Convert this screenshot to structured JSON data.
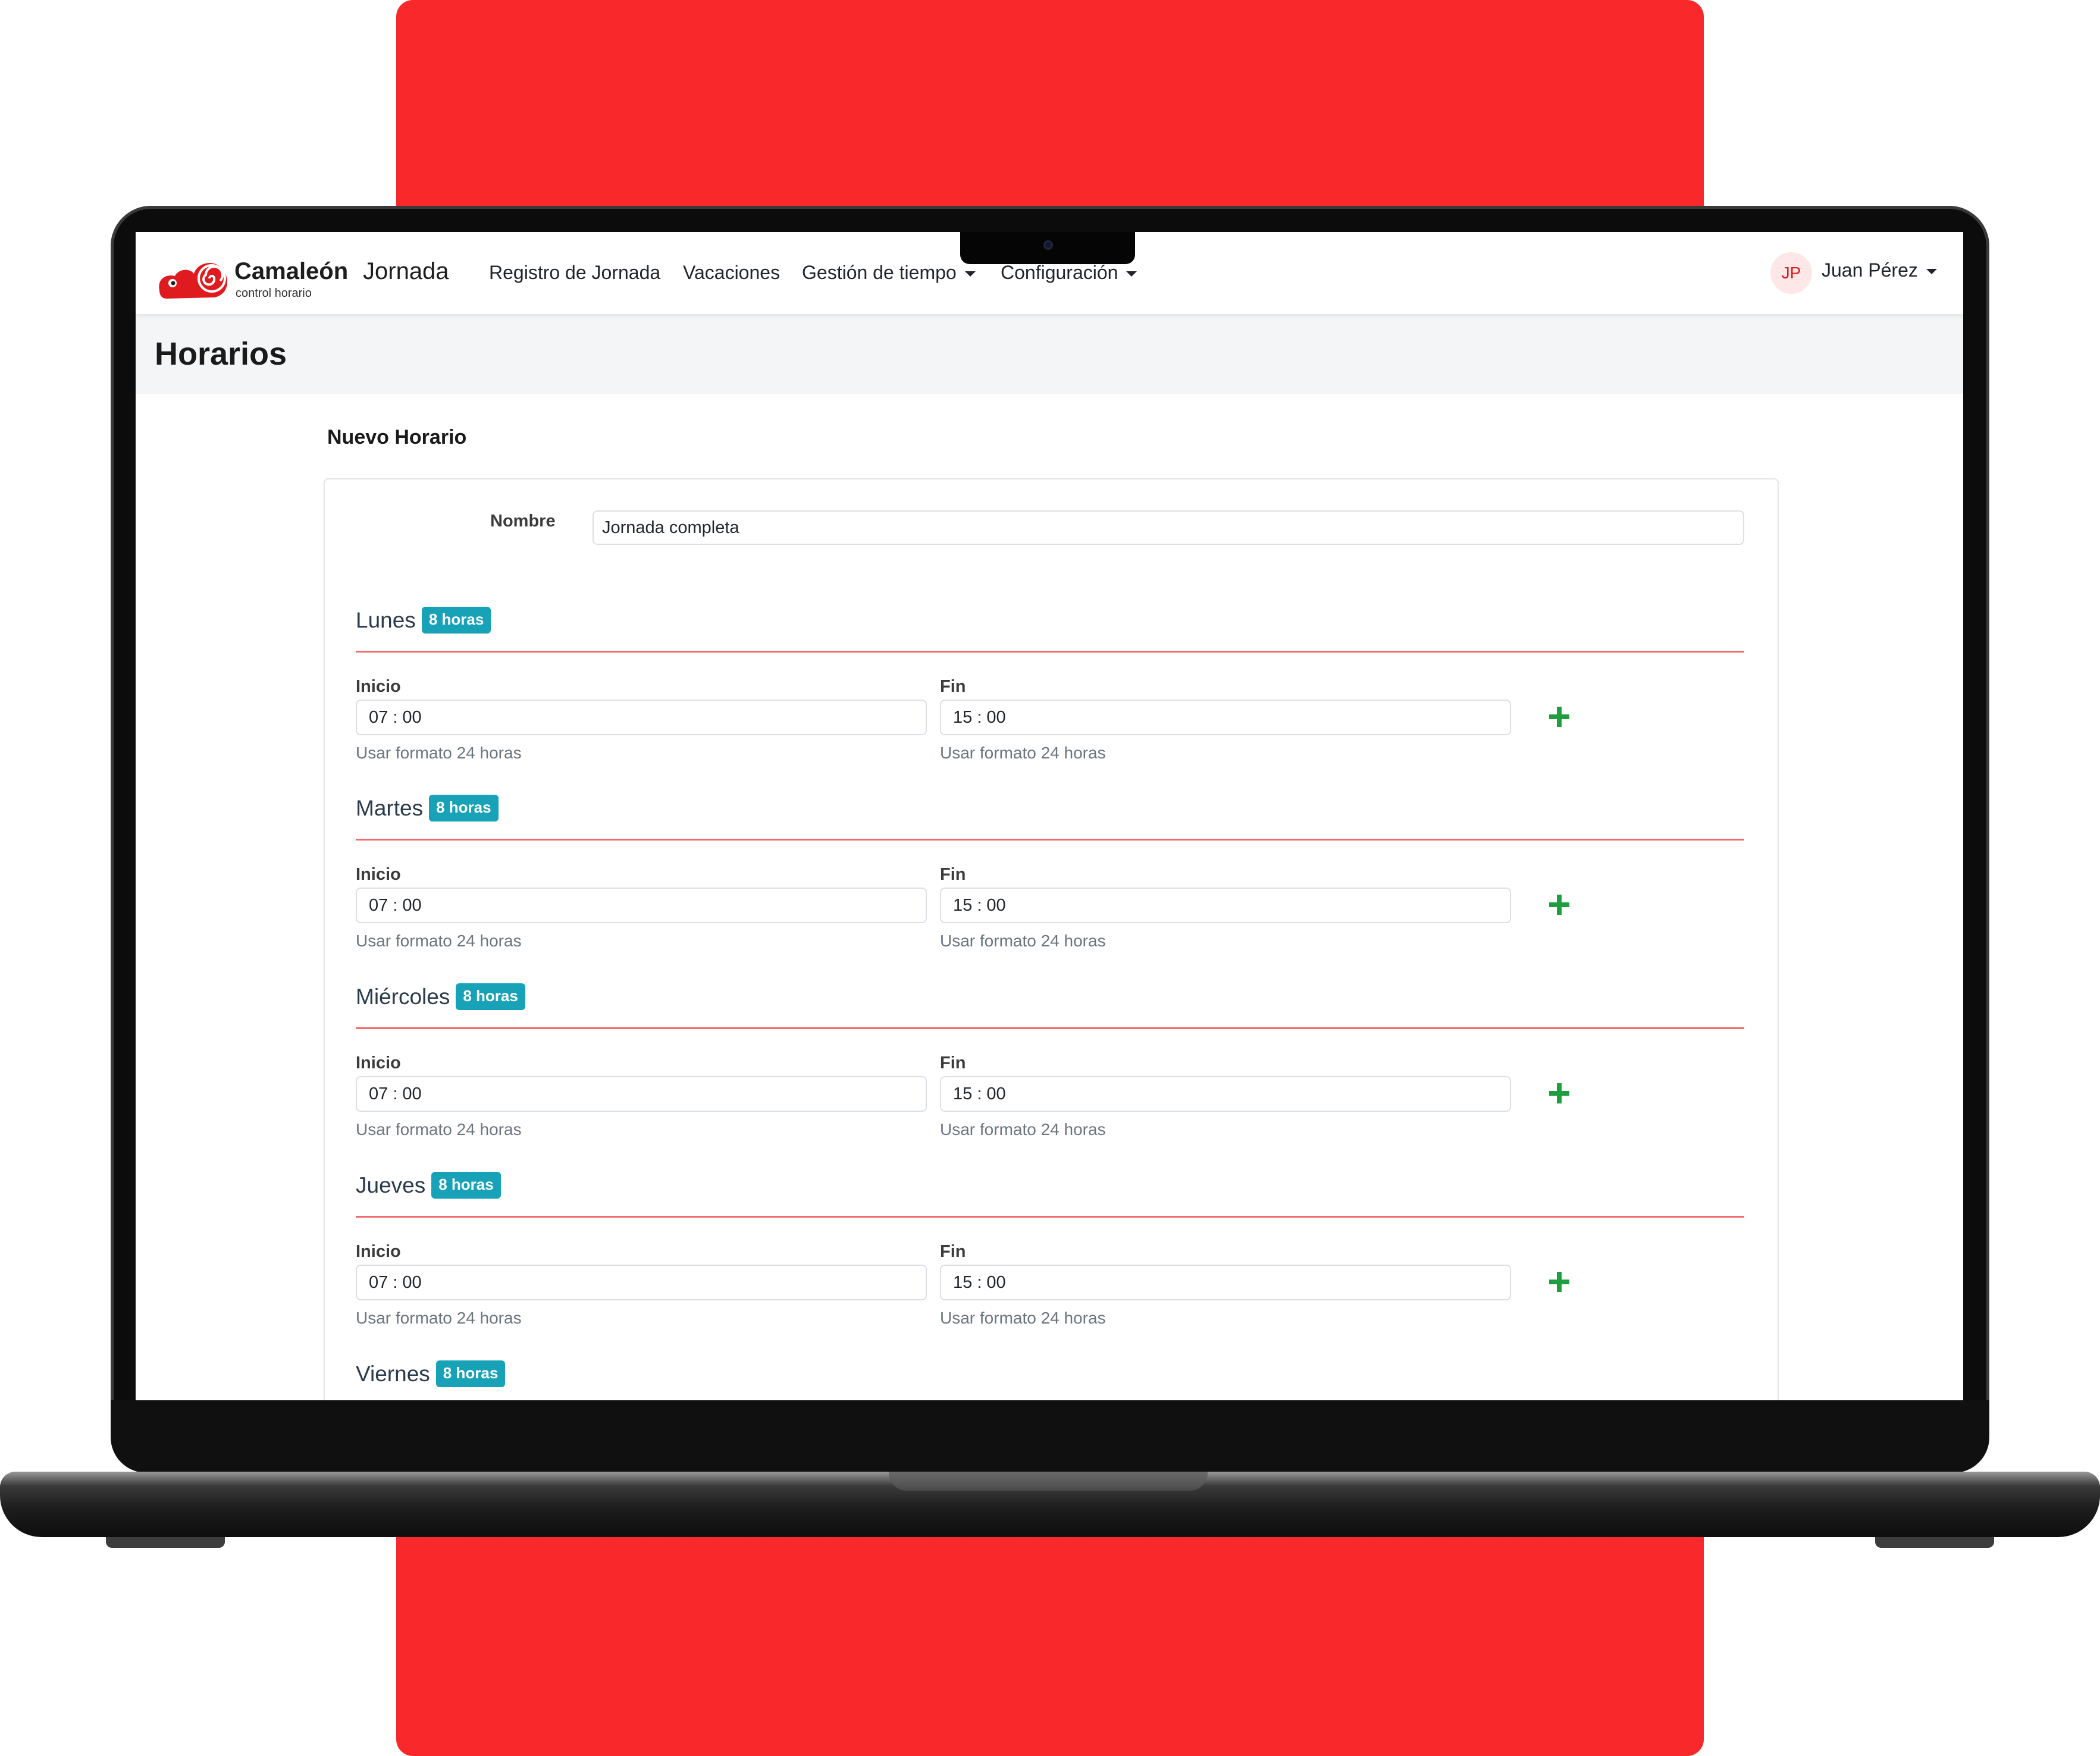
{
  "navbar": {
    "brand_bold": "Camaleón",
    "brand_light": "Jornada",
    "brand_sub": "control horario",
    "items": [
      {
        "label": "Registro de Jornada"
      },
      {
        "label": "Vacaciones"
      },
      {
        "label": "Gestión de tiempo"
      },
      {
        "label": "Configuración"
      }
    ],
    "user": {
      "initials": "JP",
      "name": "Juan Pérez"
    }
  },
  "page": {
    "title": "Horarios"
  },
  "form": {
    "section_title": "Nuevo Horario",
    "nombre_label": "Nombre",
    "nombre_value": "Jornada completa",
    "inicio_label": "Inicio",
    "fin_label": "Fin",
    "hint": "Usar formato 24 horas",
    "days": [
      {
        "name": "Lunes",
        "badge": "8 horas",
        "inicio": "07 : 00",
        "fin": "15 : 00"
      },
      {
        "name": "Martes",
        "badge": "8 horas",
        "inicio": "07 : 00",
        "fin": "15 : 00"
      },
      {
        "name": "Miércoles",
        "badge": "8 horas",
        "inicio": "07 : 00",
        "fin": "15 : 00"
      },
      {
        "name": "Jueves",
        "badge": "8 horas",
        "inicio": "07 : 00",
        "fin": "15 : 00"
      },
      {
        "name": "Viernes",
        "badge": "8 horas",
        "inicio": "",
        "fin": ""
      }
    ]
  },
  "colors": {
    "accent_red": "#f8282b",
    "badge": "#17a2b8",
    "plus": "#1e9e3e",
    "rule": "#f26b6d"
  },
  "icons": {
    "logo": "chameleon-logo-icon",
    "add": "plus-icon",
    "dropdown": "caret-down-icon"
  }
}
